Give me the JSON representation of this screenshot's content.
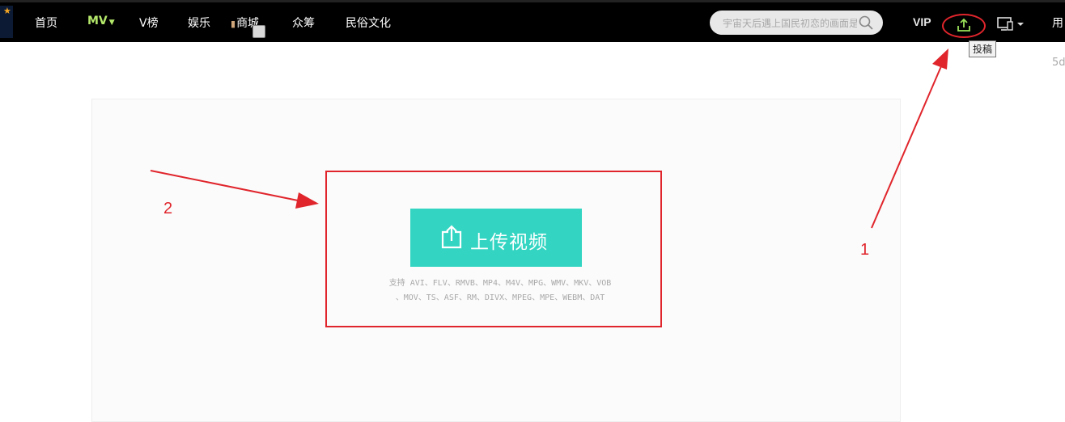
{
  "nav": {
    "items": [
      {
        "label": "首页"
      },
      {
        "label": "MV",
        "has_dropdown": true,
        "highlight": true
      },
      {
        "label": "V榜"
      },
      {
        "label": "娱乐"
      },
      {
        "label": "商城",
        "icon": "lipstick-icon"
      },
      {
        "label": "众筹"
      },
      {
        "label": "民俗文化"
      }
    ],
    "search_placeholder": "宇宙天后遇上国民初恋的画面是",
    "vip_label": "VIP",
    "upload_icon": "upload-icon",
    "device_icon": "monitor-icon",
    "user_label_partial": "用",
    "upload_tooltip": "投稿",
    "side_text": "5d"
  },
  "main": {
    "upload_button_label": "上传视频",
    "supported_formats_line1": "支持 AVI、FLV、RMVB、MP4、M4V、MPG、WMV、MKV、VOB",
    "supported_formats_line2": "、MOV、TS、ASF、RM、DIVX、MPEG、MPE、WEBM、DAT"
  },
  "annotations": {
    "step1": "1",
    "step2": "2",
    "color": "#e0252c"
  },
  "colors": {
    "accent": "#33d5c2",
    "nav_bg": "#000000",
    "mv_highlight": "#b4e86b",
    "annotation_red": "#e0252c"
  }
}
